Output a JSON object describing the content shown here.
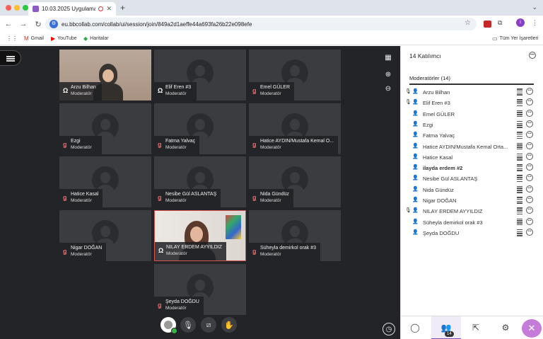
{
  "browser": {
    "tab_title": "10.03.2025 Uygulama Öğ",
    "tab_close": "✕",
    "new_tab": "+",
    "url": "eu.bbcollab.com/collab/ui/session/join/849a2d1aeffe44a693fa26b22e098efe",
    "bookmarks": [
      {
        "label": "Gmail",
        "icon": "gmail-icon"
      },
      {
        "label": "YouTube",
        "icon": "youtube-icon"
      },
      {
        "label": "Haritalar",
        "icon": "maps-icon"
      }
    ],
    "all_bookmarks": "Tüm Yer İşaretleri",
    "profile_letter": "i"
  },
  "tiles": [
    {
      "name": "Arzu Bilhan",
      "role": "Moderatör",
      "muted": false,
      "video": true
    },
    {
      "name": "Elif Eren #3",
      "role": "Moderatör",
      "muted": false,
      "video": false
    },
    {
      "name": "Emel GÜLER",
      "role": "Moderatör",
      "muted": true,
      "video": false
    },
    {
      "name": "Ezgi",
      "role": "Moderatör",
      "muted": true,
      "video": false
    },
    {
      "name": "Fatma Yalvaç",
      "role": "Moderatör",
      "muted": true,
      "video": false
    },
    {
      "name": "Hatice AYDIN/Mustafa Kemal O...",
      "role": "Moderatör",
      "muted": true,
      "video": false
    },
    {
      "name": "Hatice Kasal",
      "role": "Moderatör",
      "muted": true,
      "video": false
    },
    {
      "name": "Nesibe Gül ASLANTAŞ",
      "role": "Moderatör",
      "muted": true,
      "video": false
    },
    {
      "name": "Nida Gündüz",
      "role": "Moderatör",
      "muted": true,
      "video": false
    },
    {
      "name": "Nigar DOĞAN",
      "role": "Moderatör",
      "muted": true,
      "video": false
    },
    {
      "name": "NILAY ERDEM AYYILDIZ",
      "role": "Moderatör",
      "muted": false,
      "video": true
    },
    {
      "name": "Süheyla demirkol orak #3",
      "role": "Moderatör",
      "muted": true,
      "video": false
    },
    {
      "name": "Şeyda DOĞDU",
      "role": "Moderatör",
      "muted": true,
      "video": false
    }
  ],
  "panel": {
    "title": "14 Katılımcı",
    "section": "Moderatörler (14)",
    "participants": [
      {
        "name": "Arzu Bilhan",
        "mic": true,
        "bold": false
      },
      {
        "name": "Elif Eren #3",
        "mic": true,
        "bold": false
      },
      {
        "name": "Emel GÜLER",
        "mic": false,
        "bold": false
      },
      {
        "name": "Ezgi",
        "mic": false,
        "bold": false
      },
      {
        "name": "Fatma Yalvaç",
        "mic": false,
        "bold": false
      },
      {
        "name": "Hatice AYDIN/Mustafa Kemal Orta...",
        "mic": false,
        "bold": false
      },
      {
        "name": "Hatice Kasal",
        "mic": false,
        "bold": false
      },
      {
        "name": "ilayda erdem #2",
        "mic": false,
        "bold": true
      },
      {
        "name": "Nesibe Gül ASLANTAŞ",
        "mic": false,
        "bold": false
      },
      {
        "name": "Nida Gündüz",
        "mic": false,
        "bold": false
      },
      {
        "name": "Nigar DOĞAN",
        "mic": false,
        "bold": false
      },
      {
        "name": "NILAY ERDEM AYYILDIZ",
        "mic": true,
        "bold": false
      },
      {
        "name": "Süheyla demirkol orak #3",
        "mic": false,
        "bold": false
      },
      {
        "name": "Şeyda DOĞDU",
        "mic": false,
        "bold": false
      }
    ],
    "participants_count": "14"
  },
  "colors": {
    "accent": "#7d4cbf",
    "stage": "#222428",
    "muted": "#e06b6b"
  }
}
